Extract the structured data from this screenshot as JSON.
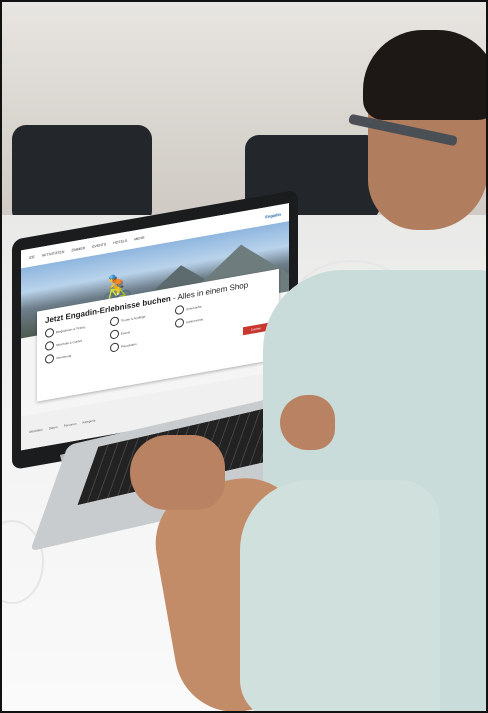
{
  "laptop_page": {
    "nav": [
      "IDE",
      "AKTIVITÄTEN",
      "ZIMMER",
      "EVENTS",
      "HOTELS",
      "MEHR"
    ],
    "logo": "Engadin",
    "hero_title": "Jetzt Engadin-Erlebnisse buchen",
    "hero_subtitle": " - Alles in einem Shop",
    "categories": [
      "Bergbahnen & Tickets",
      "Touren & Ausflüge",
      "Unterkünfte",
      "Skischule & Guides",
      "Events",
      "Gastronomie",
      "Vermietung",
      "Pauschalen"
    ],
    "book_button": "Suchen",
    "filters": [
      "Aktivitäten",
      "Datum",
      "Personen",
      "Kategorie"
    ]
  }
}
